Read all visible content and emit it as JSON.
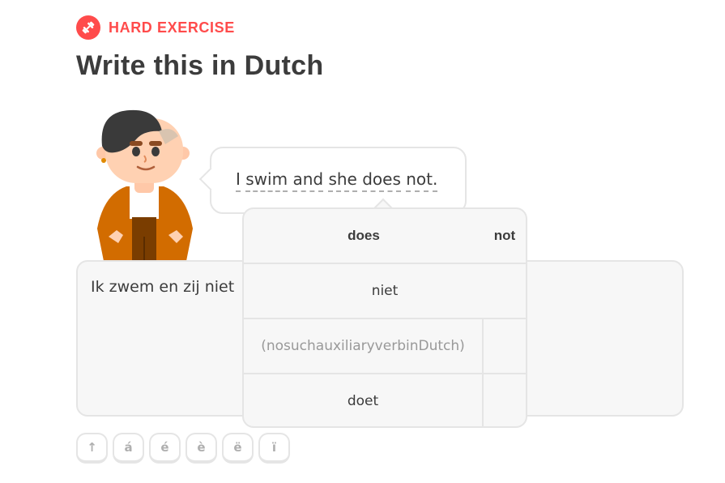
{
  "header": {
    "badge_icon": "dumbbell-icon",
    "badge_label": "HARD EXERCISE",
    "title": "Write this in Dutch"
  },
  "prompt": {
    "words": [
      "I",
      "swim",
      "and",
      "she",
      "does",
      "not."
    ]
  },
  "answer": {
    "value": "Ik zwem en zij niet"
  },
  "popup": {
    "headers": [
      "does",
      "not"
    ],
    "rows": [
      "niet",
      "(nosuchauxiliaryverbinDutch)",
      "doet"
    ]
  },
  "special_keys": [
    "↑",
    "á",
    "é",
    "è",
    "ë",
    "ï"
  ],
  "colors": {
    "accent": "#ff4b4b",
    "text": "#3c3c3c",
    "border": "#e5e5e5",
    "muted": "#afafaf",
    "hair": "#3a3a3a",
    "jacket": "#d26c00"
  }
}
